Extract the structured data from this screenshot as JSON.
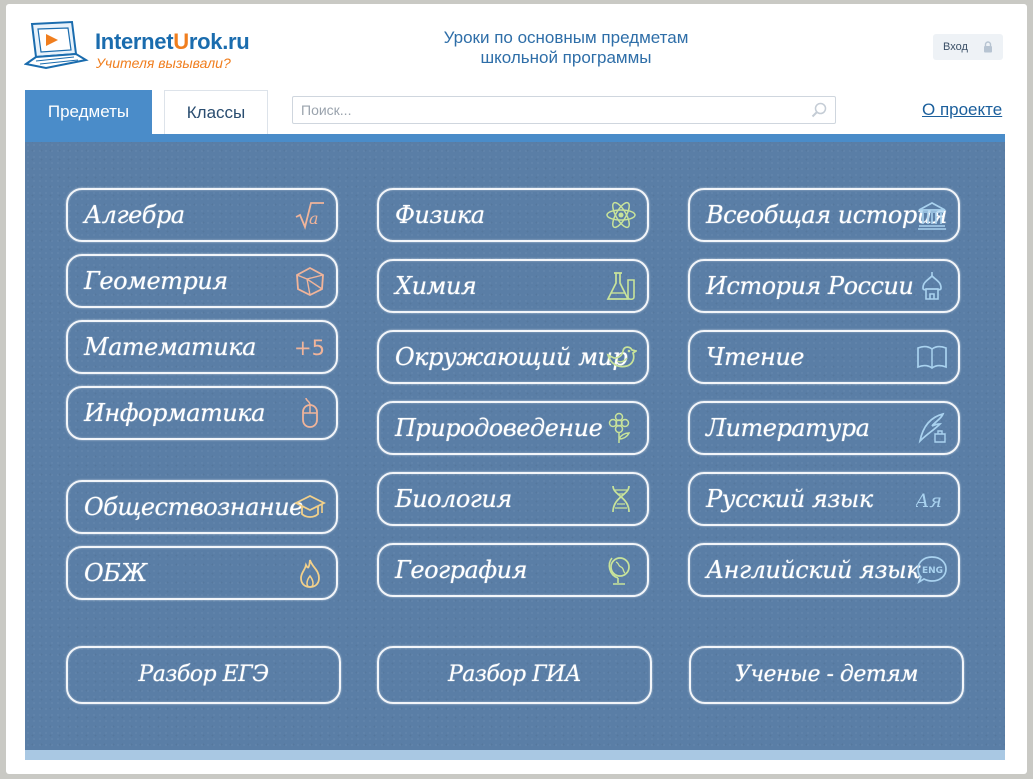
{
  "header": {
    "logo_part1": "Internet",
    "logo_part2": "U",
    "logo_part3": "rok.ru",
    "slogan": "Учителя вызывали?",
    "title_line1": "Уроки по основным предметам",
    "title_line2": "школьной программы",
    "login_label": "Вход"
  },
  "nav": {
    "tab_subjects": "Предметы",
    "tab_classes": "Классы",
    "search_placeholder": "Поиск...",
    "about_label": "О проекте"
  },
  "subjects": {
    "col1": [
      {
        "label": "Алгебра",
        "icon": "sqrt-a-icon",
        "color": "#f0b49a"
      },
      {
        "label": "Геометрия",
        "icon": "polyhedron-icon",
        "color": "#f0b49a"
      },
      {
        "label": "Математика",
        "icon": "plus-five-icon",
        "color": "#f0b49a"
      },
      {
        "label": "Информатика",
        "icon": "mouse-icon",
        "color": "#f0b49a"
      },
      {
        "label": "Обществознание",
        "icon": "graduation-cap-icon",
        "color": "#f2d08a"
      },
      {
        "label": "ОБЖ",
        "icon": "fire-icon",
        "color": "#f2d08a"
      }
    ],
    "col2": [
      {
        "label": "Физика",
        "icon": "atom-icon",
        "color": "#c8e39a"
      },
      {
        "label": "Химия",
        "icon": "flask-icon",
        "color": "#c8e39a"
      },
      {
        "label": "Окружающий мир",
        "icon": "bird-icon",
        "color": "#c8e39a"
      },
      {
        "label": "Природоведение",
        "icon": "flower-icon",
        "color": "#c8e39a"
      },
      {
        "label": "Биология",
        "icon": "dna-icon",
        "color": "#c8e39a"
      },
      {
        "label": "География",
        "icon": "globe-icon",
        "color": "#c8e39a"
      }
    ],
    "col3": [
      {
        "label": "Всеобщая история",
        "icon": "museum-icon",
        "color": "#a9d2ef"
      },
      {
        "label": "История России",
        "icon": "church-dome-icon",
        "color": "#a9d2ef"
      },
      {
        "label": "Чтение",
        "icon": "open-book-icon",
        "color": "#a9d2ef"
      },
      {
        "label": "Литература",
        "icon": "quill-icon",
        "color": "#a9d2ef"
      },
      {
        "label": "Русский язык",
        "icon": "letters-aya-icon",
        "color": "#a9d2ef"
      },
      {
        "label": "Английский язык",
        "icon": "eng-bubble-icon",
        "color": "#a9d2ef"
      }
    ]
  },
  "extra": {
    "ege": "Разбор ЕГЭ",
    "gia": "Разбор ГИА",
    "students": "Ученые - детям"
  },
  "icon_text": {
    "sqrt_a": "a",
    "plus_five": "+5",
    "aya": "Ая",
    "eng": "ENG"
  }
}
